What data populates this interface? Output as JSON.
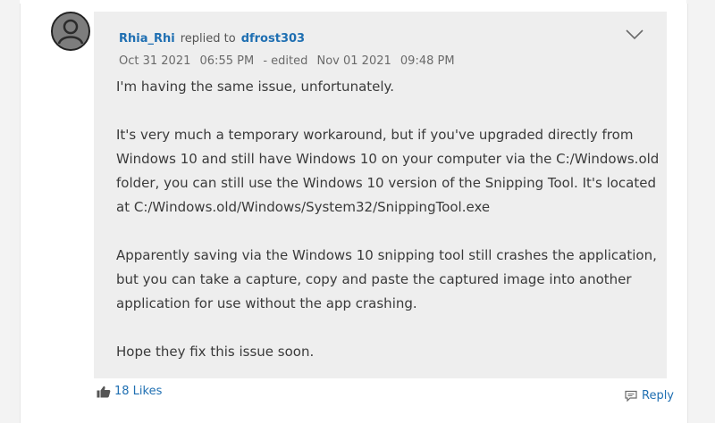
{
  "post": {
    "author": "Rhia_Rhi",
    "replied_to_label": "replied to",
    "replied_to_user": "dfrost303",
    "posted_date": "Oct 31 2021",
    "posted_time": "06:55 PM",
    "edited_label": "- edited",
    "edited_date": "Nov 01 2021",
    "edited_time": "09:48 PM",
    "paragraphs": [
      "I'm having the same issue, unfortunately.",
      "It's very much a temporary workaround, but if you've upgraded directly from Windows 10 and still have Windows 10 on your computer via the C:/Windows.old folder, you can still use the Windows 10 version of the Snipping Tool. It's located at C:/Windows.old/Windows/System32/SnippingTool.exe",
      "Apparently saving via the Windows 10 snipping tool still crashes the application, but you can take a capture, copy and paste the captured image into another application for use without the app crashing.",
      "Hope they fix this issue soon."
    ]
  },
  "footer": {
    "likes_label": "18 Likes",
    "reply_label": "Reply"
  },
  "icons": {
    "avatar": "user-avatar-icon",
    "menu": "chevron-down-icon",
    "like": "thumbs-up-icon",
    "reply": "reply-bubble-icon"
  },
  "colors": {
    "link": "#1f6fb2",
    "post_background": "#eeeeee"
  }
}
